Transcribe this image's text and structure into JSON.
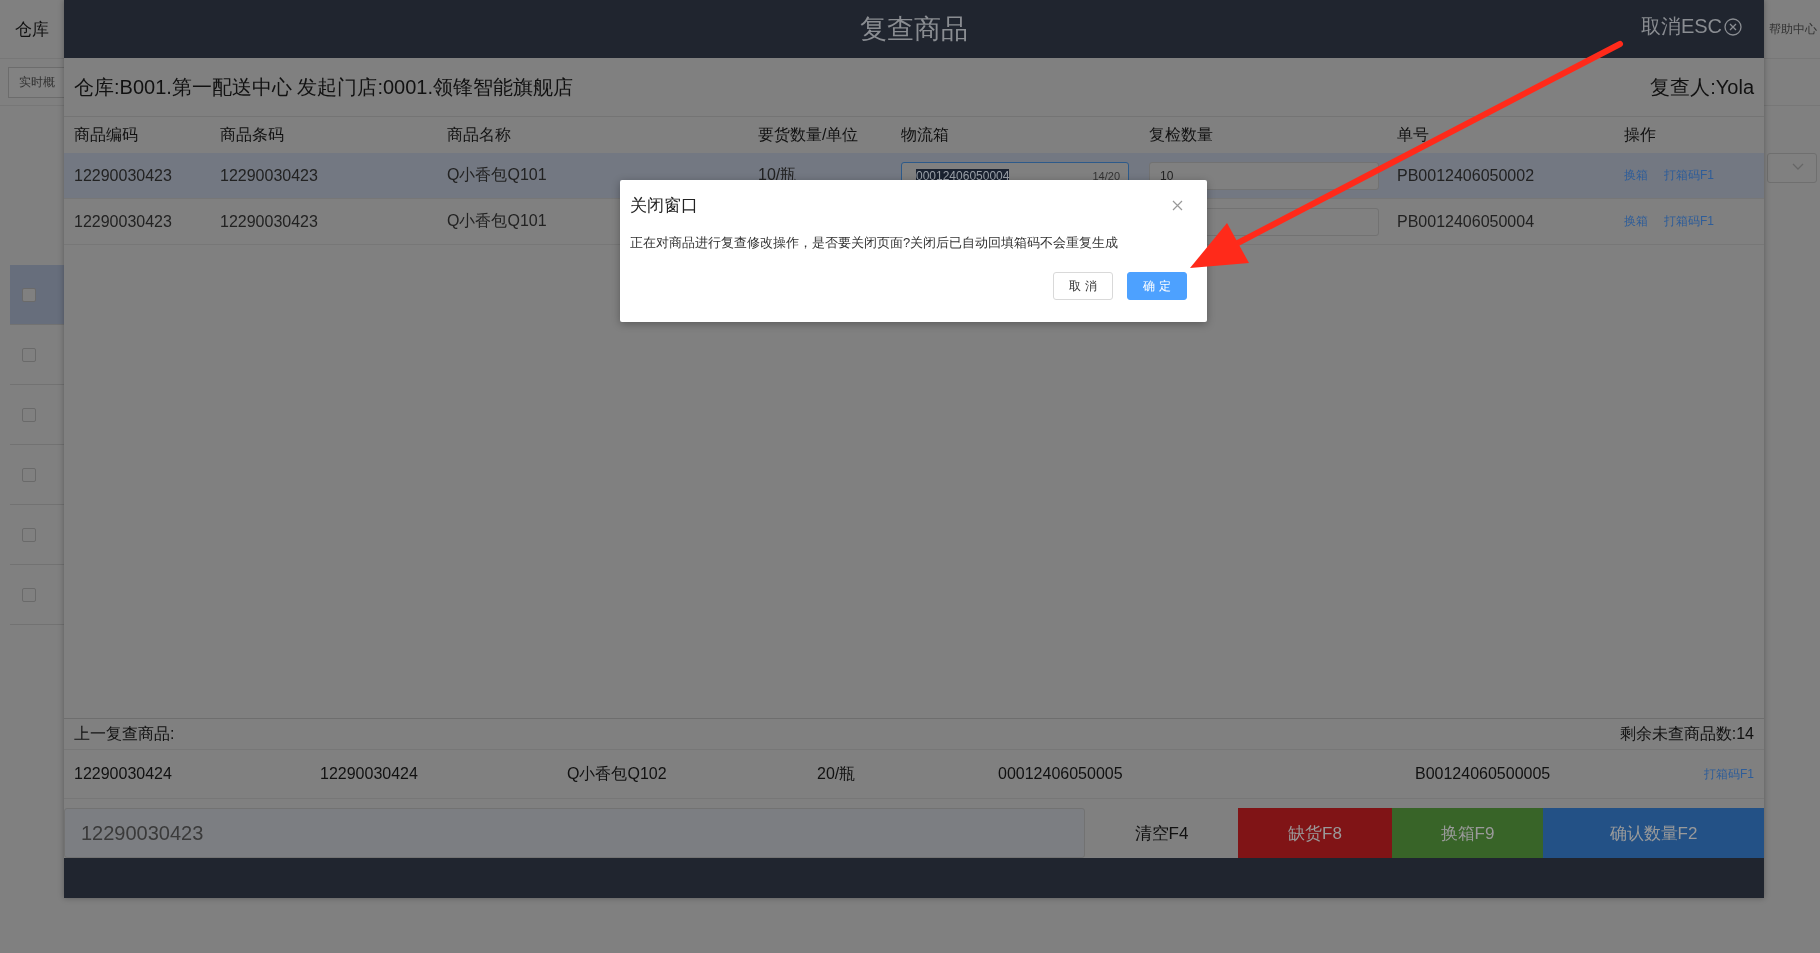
{
  "background_page": {
    "title": "仓库",
    "tab": "实时概",
    "help": "帮助中心",
    "rows": [
      {
        "selected": true,
        "checked": false
      },
      {
        "selected": false,
        "checked": false
      },
      {
        "selected": false,
        "checked": false
      },
      {
        "selected": false,
        "checked": false
      },
      {
        "selected": false,
        "checked": false
      },
      {
        "selected": false,
        "checked": false
      }
    ]
  },
  "modal": {
    "title": "复查商品",
    "cancel": "取消ESC",
    "info": {
      "warehouse": "仓库:B001.第一配送中心 发起门店:0001.领锋智能旗舰店",
      "reviewer": "复查人:Yola"
    },
    "table": {
      "columns": [
        "商品编码",
        "商品条码",
        "商品名称",
        "要货数量/单位",
        "物流箱",
        "复检数量",
        "单号",
        "操作"
      ],
      "rows": [
        {
          "selected": true,
          "code": "12290030423",
          "barcode": "12290030423",
          "name": "Q小香包Q101",
          "qty": "10/瓶",
          "box": {
            "value": "00012406050004",
            "counter": "14/20"
          },
          "check_qty": "10",
          "order": "PB0012406050002",
          "actions": [
            "换箱",
            "打箱码F1"
          ]
        },
        {
          "selected": false,
          "code": "12290030423",
          "barcode": "12290030423",
          "name": "Q小香包Q101",
          "order": "PB0012406050004",
          "actions": [
            "换箱",
            "打箱码F1"
          ]
        }
      ]
    },
    "last": {
      "label": "上一复查商品:",
      "remaining": "剩余未查商品数:14",
      "values": [
        "12290030424",
        "12290030424",
        "Q小香包Q102",
        "20/瓶",
        "00012406050005",
        "B00124060500005"
      ],
      "link": "打箱码F1"
    },
    "scan": {
      "value": "12290030423"
    },
    "buttons": [
      {
        "label": "清空F4",
        "kind": "plain"
      },
      {
        "label": "缺货F8",
        "kind": "danger"
      },
      {
        "label": "换箱F9",
        "kind": "success"
      },
      {
        "label": "确认数量F2",
        "kind": "primary"
      }
    ]
  },
  "dialog": {
    "title": "关闭窗口",
    "message": "正在对商品进行复查修改操作，是否要关闭页面?关闭后已自动回填箱码不会重复生成",
    "buttons": [
      {
        "label": "取 消",
        "kind": "default"
      },
      {
        "label": "确 定",
        "kind": "primary"
      }
    ]
  }
}
